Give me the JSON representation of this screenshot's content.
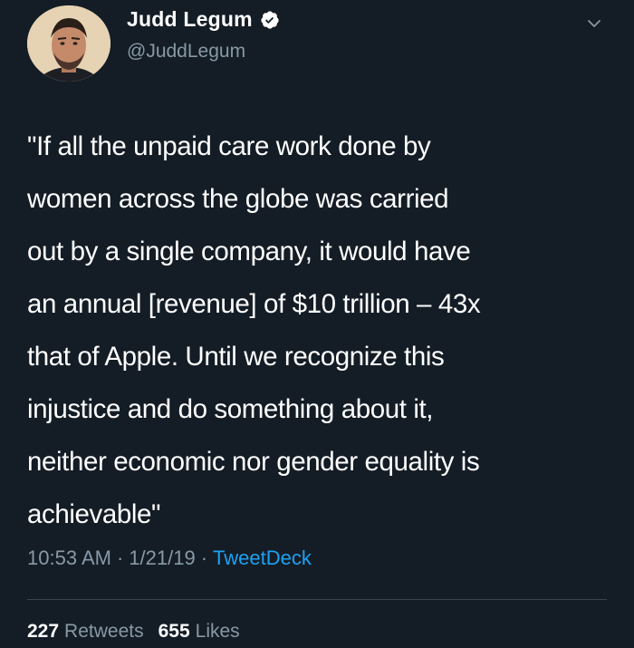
{
  "author": {
    "display_name": "Judd Legum",
    "handle": "@JuddLegum",
    "verified": true
  },
  "tweet": {
    "text": "\"If all the unpaid care work done by\nwomen across the globe was carried\nout by a single company, it would have\nan annual [revenue] of $10 trillion – 43x\nthat of Apple. Until we recognize this\ninjustice and do something about it,\nneither economic nor gender equality is\nachievable\"",
    "time": "10:53 AM",
    "date": "1/21/19",
    "source": "TweetDeck",
    "separator": "·"
  },
  "stats": {
    "retweets_count": "227",
    "retweets_label": "Retweets",
    "likes_count": "655",
    "likes_label": "Likes"
  },
  "icons": {
    "verified": "verified-badge-icon",
    "menu": "chevron-down-icon"
  },
  "colors": {
    "background": "#141d26",
    "primary_text": "#ffffff",
    "secondary_text": "#8899a6",
    "link": "#1da1f2",
    "divider": "#38444d"
  }
}
